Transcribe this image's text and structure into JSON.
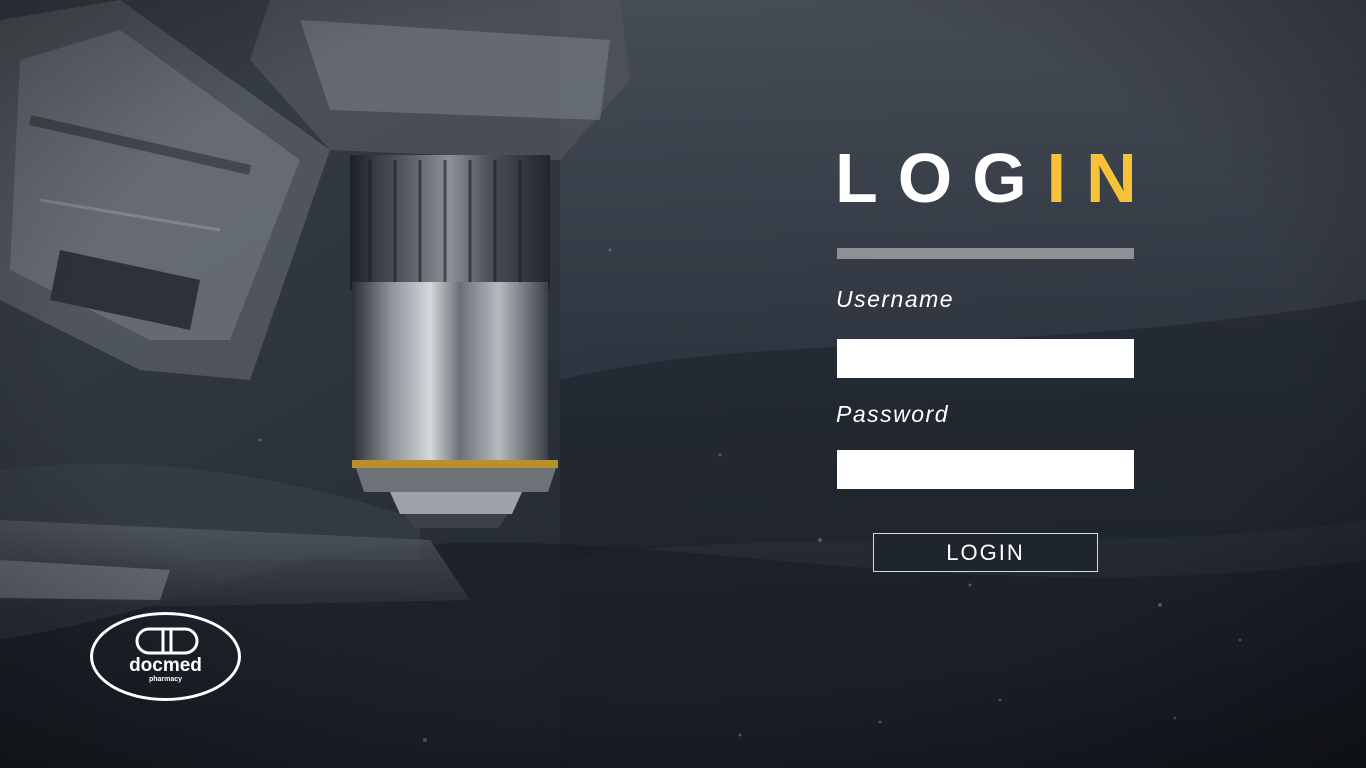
{
  "login": {
    "title_main": "LOG",
    "title_accent": "IN",
    "username_label": "Username",
    "username_value": "",
    "password_label": "Password",
    "password_value": "",
    "button_label": "LOGIN"
  },
  "logo": {
    "name": "docmed",
    "tagline": "pharmacy"
  },
  "colors": {
    "accent": "#f6c338",
    "background": "#1d222b",
    "divider": "#8d9094"
  },
  "icons": {
    "logo": "pill-capsule-icon",
    "background": "microscope-photo"
  }
}
